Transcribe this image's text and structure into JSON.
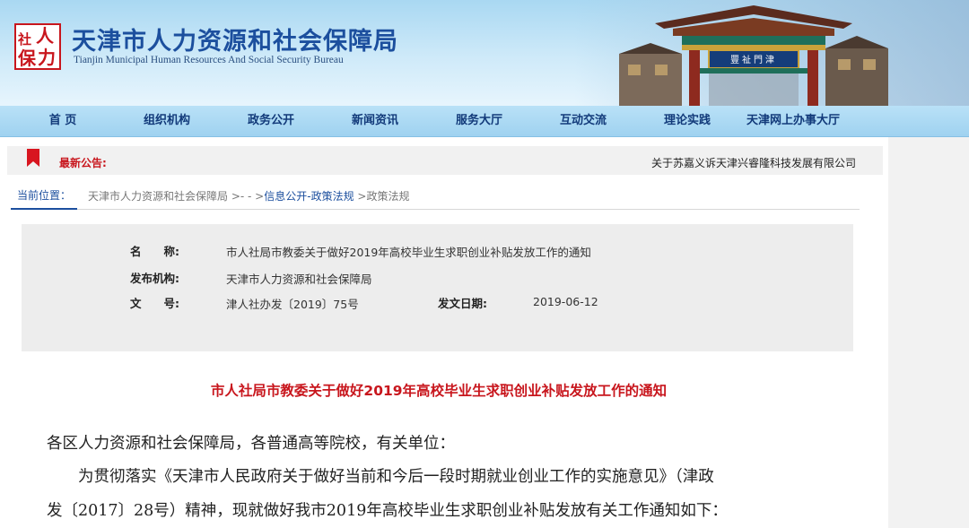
{
  "header": {
    "logo_chars": [
      "人",
      "社",
      "力",
      "保"
    ],
    "site_title": "天津市人力资源和社会保障局",
    "site_subtitle": "Tianjin Municipal Human Resources And Social Security Bureau",
    "gate_plaque": "豐祉門津"
  },
  "nav": {
    "items": [
      "首 页",
      "组织机构",
      "政务公开",
      "新闻资讯",
      "服务大厅",
      "互动交流",
      "理论实践",
      "天津网上办事大厅"
    ]
  },
  "notice": {
    "label": "最新公告:",
    "text": "关于苏嘉义诉天津兴睿隆科技发展有限公司"
  },
  "breadcrumb": {
    "label": "当前位置：",
    "site": "天津市人力资源和社会保障局",
    "sep1": " >- - >",
    "section": "信息公开-政策法规",
    "sep2": " >",
    "current": "政策法规"
  },
  "meta": {
    "name_label": "名　　称:",
    "name_value": "市人社局市教委关于做好2019年高校毕业生求职创业补贴发放工作的通知",
    "issuer_label": "发布机构:",
    "issuer_value": "天津市人力资源和社会保障局",
    "docno_label": "文　　号:",
    "docno_value": "津人社办发〔2019〕75号",
    "date_label": "发文日期:",
    "date_value": "2019-06-12"
  },
  "document": {
    "title": "市人社局市教委关于做好2019年高校毕业生求职创业补贴发放工作的通知",
    "salutation": "各区人力资源和社会保障局，各普通高等院校，有关单位：",
    "para1_line1": "　　为贯彻落实《天津市人民政府关于做好当前和今后一段时期就业创业工作的实施意见》（津政",
    "para1_line2": "发〔2017〕28号）精神，现就做好我市2019年高校毕业生求职创业补贴发放有关工作通知如下："
  },
  "colors": {
    "brand_blue": "#1c4f9e",
    "accent_red": "#c8161d",
    "nav_bg": "#a9d8f2"
  }
}
